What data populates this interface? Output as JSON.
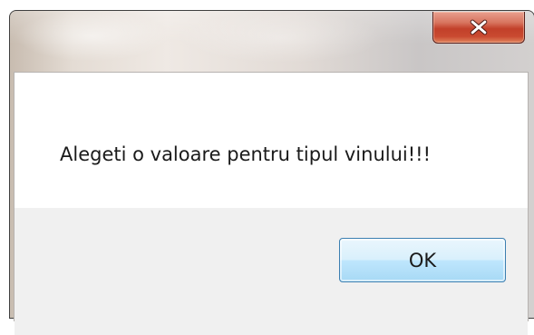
{
  "dialog": {
    "title": "",
    "message": "Alegeti o valoare pentru tipul vinului!!!",
    "ok_label": "OK",
    "close_glyph": "close-icon"
  },
  "colors": {
    "close_button_red": "#c2402a",
    "ok_button_border": "#3c7fb1",
    "footer_bg": "#f0f0f0"
  }
}
